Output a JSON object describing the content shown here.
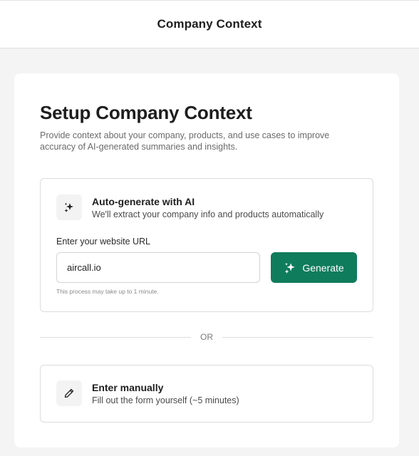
{
  "header": {
    "title": "Company Context"
  },
  "setup": {
    "heading": "Setup Company Context",
    "description": "Provide context about your company, products, and use cases to improve accuracy of AI-generated summaries and insights."
  },
  "auto_generate": {
    "icon": "sparkles-icon",
    "title": "Auto-generate with AI",
    "subtitle": "We'll extract your company info and products automatically",
    "url_label": "Enter your website URL",
    "url_value": "aircall.io",
    "button_label": "Generate",
    "button_icon": "sparkles-icon",
    "hint": "This process may take up to 1 minute."
  },
  "divider": {
    "label": "OR"
  },
  "manual": {
    "icon": "pencil-icon",
    "title": "Enter manually",
    "subtitle": "Fill out the form yourself (~5 minutes)"
  },
  "colors": {
    "accent": "#0f7c5b",
    "background": "#f4f4f4",
    "card_border": "#dcdcdc"
  }
}
